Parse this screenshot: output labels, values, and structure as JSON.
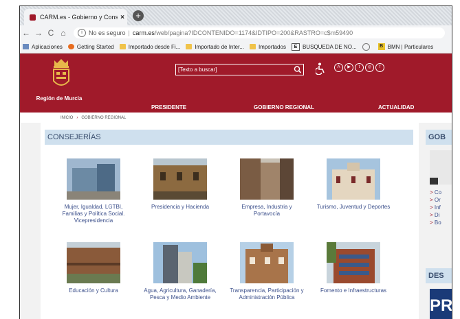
{
  "browser": {
    "tab_title": "CARM.es - Gobierno y Consejeri",
    "address": {
      "security": "No es seguro",
      "host": "carm.es",
      "path": "/web/pagina?IDCONTENIDO=1174&IDTIPO=200&RASTRO=c$m59490"
    },
    "bookmarks": [
      {
        "label": "Aplicaciones",
        "icon": "apps-icon"
      },
      {
        "label": "Getting Started",
        "icon": "firefox-icon"
      },
      {
        "label": "Importado desde Fi...",
        "icon": "folder-icon"
      },
      {
        "label": "Importado de Inter...",
        "icon": "folder-icon"
      },
      {
        "label": "Importados",
        "icon": "folder-icon"
      },
      {
        "label": "BUSQUEDA DE NO...",
        "icon": "e-icon"
      },
      {
        "label": "",
        "icon": "globe-icon"
      },
      {
        "label": "BMN | Particulares",
        "icon": "bmn-icon"
      }
    ]
  },
  "site": {
    "region_name": "Región de Murcia",
    "search_placeholder": "[Texto a buscar]",
    "nav": [
      "PRESIDENTE",
      "GOBIERNO REGIONAL",
      "ACTUALIDAD"
    ],
    "breadcrumb": [
      "INICIO",
      "GOBIERNO REGIONAL"
    ],
    "section_title": "CONSEJERÍAS",
    "side_title": "GOB",
    "side_links": [
      "Co",
      "Or",
      "Inf",
      "Di",
      "Bo"
    ],
    "side2_title": "DES",
    "side2_image_text": "PR",
    "consejerias": [
      {
        "label": "Mujer, Igualdad, LGTBI, Familias y Política Social. Vicepresidencia"
      },
      {
        "label": "Presidencia y Hacienda"
      },
      {
        "label": "Empresa, Industria y Portavocía"
      },
      {
        "label": "Turismo, Juventud y Deportes"
      },
      {
        "label": "Educación y Cultura"
      },
      {
        "label": "Agua, Agricultura, Ganadería, Pesca y Medio Ambiente"
      },
      {
        "label": "Transparencia, Participación y Administración Pública"
      },
      {
        "label": "Fomento e Infraestructuras"
      }
    ]
  },
  "colors": {
    "brand": "#a01a2a",
    "section_bg": "#cfe0ee",
    "link": "#3a4e8a"
  }
}
